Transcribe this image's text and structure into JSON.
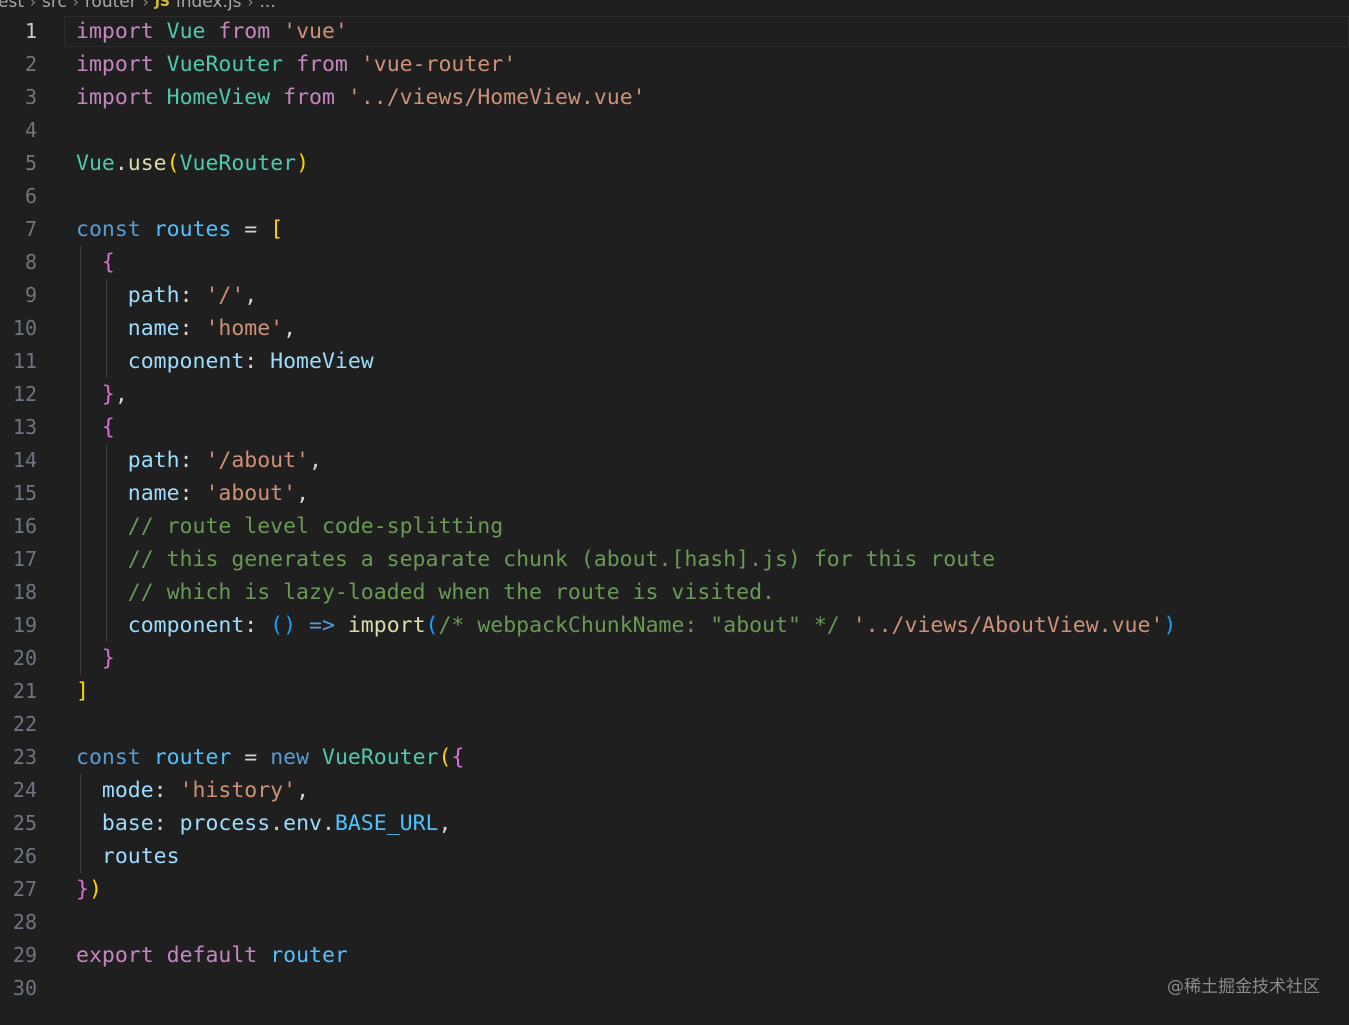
{
  "breadcrumb": [
    "est",
    "src",
    "router",
    "JS",
    "index.js",
    "..."
  ],
  "current_line": 1,
  "colors": {
    "keyword": "#c586c0",
    "declaration": "#569cd6",
    "variable": "#4fc1ff",
    "class": "#4ec9b0",
    "string": "#ce9178",
    "property": "#9cdcfe",
    "function": "#dcdcaa",
    "comment": "#6a9955",
    "bracket_level1": "#ffd700",
    "bracket_level2": "#da70d6",
    "bracket_level3": "#179fff"
  },
  "lines": [
    {
      "n": "1",
      "indent": 0,
      "tokens": [
        [
          "keyword",
          "import"
        ],
        [
          "p",
          " "
        ],
        [
          "class",
          "Vue"
        ],
        [
          "p",
          " "
        ],
        [
          "keyword",
          "from"
        ],
        [
          "p",
          " "
        ],
        [
          "string",
          "'vue'"
        ]
      ]
    },
    {
      "n": "2",
      "indent": 0,
      "tokens": [
        [
          "keyword",
          "import"
        ],
        [
          "p",
          " "
        ],
        [
          "class",
          "VueRouter"
        ],
        [
          "p",
          " "
        ],
        [
          "keyword",
          "from"
        ],
        [
          "p",
          " "
        ],
        [
          "string",
          "'vue-router'"
        ]
      ]
    },
    {
      "n": "3",
      "indent": 0,
      "tokens": [
        [
          "keyword",
          "import"
        ],
        [
          "p",
          " "
        ],
        [
          "class",
          "HomeView"
        ],
        [
          "p",
          " "
        ],
        [
          "keyword",
          "from"
        ],
        [
          "p",
          " "
        ],
        [
          "string",
          "'../views/HomeView.vue'"
        ]
      ]
    },
    {
      "n": "4",
      "indent": 0,
      "tokens": []
    },
    {
      "n": "5",
      "indent": 0,
      "tokens": [
        [
          "class",
          "Vue"
        ],
        [
          "p",
          "."
        ],
        [
          "function",
          "use"
        ],
        [
          "br1",
          "("
        ],
        [
          "class",
          "VueRouter"
        ],
        [
          "br1",
          ")"
        ]
      ]
    },
    {
      "n": "6",
      "indent": 0,
      "tokens": []
    },
    {
      "n": "7",
      "indent": 0,
      "tokens": [
        [
          "decl",
          "const"
        ],
        [
          "p",
          " "
        ],
        [
          "var",
          "routes"
        ],
        [
          "p",
          " = "
        ],
        [
          "br1",
          "["
        ]
      ]
    },
    {
      "n": "8",
      "indent": 1,
      "tokens": [
        [
          "p",
          "  "
        ],
        [
          "br2",
          "{"
        ]
      ]
    },
    {
      "n": "9",
      "indent": 2,
      "tokens": [
        [
          "p",
          "    "
        ],
        [
          "prop",
          "path"
        ],
        [
          "p",
          ": "
        ],
        [
          "string",
          "'/'"
        ],
        [
          "p",
          ","
        ]
      ]
    },
    {
      "n": "10",
      "indent": 2,
      "tokens": [
        [
          "p",
          "    "
        ],
        [
          "prop",
          "name"
        ],
        [
          "p",
          ": "
        ],
        [
          "string",
          "'home'"
        ],
        [
          "p",
          ","
        ]
      ]
    },
    {
      "n": "11",
      "indent": 2,
      "tokens": [
        [
          "p",
          "    "
        ],
        [
          "prop",
          "component"
        ],
        [
          "p",
          ": "
        ],
        [
          "prop",
          "HomeView"
        ]
      ]
    },
    {
      "n": "12",
      "indent": 1,
      "tokens": [
        [
          "p",
          "  "
        ],
        [
          "br2",
          "}"
        ],
        [
          "p",
          ","
        ]
      ]
    },
    {
      "n": "13",
      "indent": 1,
      "tokens": [
        [
          "p",
          "  "
        ],
        [
          "br2",
          "{"
        ]
      ]
    },
    {
      "n": "14",
      "indent": 2,
      "tokens": [
        [
          "p",
          "    "
        ],
        [
          "prop",
          "path"
        ],
        [
          "p",
          ": "
        ],
        [
          "string",
          "'/about'"
        ],
        [
          "p",
          ","
        ]
      ]
    },
    {
      "n": "15",
      "indent": 2,
      "tokens": [
        [
          "p",
          "    "
        ],
        [
          "prop",
          "name"
        ],
        [
          "p",
          ": "
        ],
        [
          "string",
          "'about'"
        ],
        [
          "p",
          ","
        ]
      ]
    },
    {
      "n": "16",
      "indent": 2,
      "tokens": [
        [
          "p",
          "    "
        ],
        [
          "comment",
          "// route level code-splitting"
        ]
      ]
    },
    {
      "n": "17",
      "indent": 2,
      "tokens": [
        [
          "p",
          "    "
        ],
        [
          "comment",
          "// this generates a separate chunk (about.[hash].js) for this route"
        ]
      ]
    },
    {
      "n": "18",
      "indent": 2,
      "tokens": [
        [
          "p",
          "    "
        ],
        [
          "comment",
          "// which is lazy-loaded when the route is visited."
        ]
      ]
    },
    {
      "n": "19",
      "indent": 2,
      "tokens": [
        [
          "p",
          "    "
        ],
        [
          "prop",
          "component"
        ],
        [
          "p",
          ": "
        ],
        [
          "br3",
          "()"
        ],
        [
          "p",
          " "
        ],
        [
          "decl",
          "=>"
        ],
        [
          "p",
          " "
        ],
        [
          "function",
          "import"
        ],
        [
          "br3",
          "("
        ],
        [
          "comment",
          "/* webpackChunkName: \"about\" */"
        ],
        [
          "p",
          " "
        ],
        [
          "string",
          "'../views/AboutView.vue'"
        ],
        [
          "br3",
          ")"
        ]
      ]
    },
    {
      "n": "20",
      "indent": 1,
      "tokens": [
        [
          "p",
          "  "
        ],
        [
          "br2",
          "}"
        ]
      ]
    },
    {
      "n": "21",
      "indent": 0,
      "tokens": [
        [
          "br1",
          "]"
        ]
      ]
    },
    {
      "n": "22",
      "indent": 0,
      "tokens": []
    },
    {
      "n": "23",
      "indent": 0,
      "tokens": [
        [
          "decl",
          "const"
        ],
        [
          "p",
          " "
        ],
        [
          "var",
          "router"
        ],
        [
          "p",
          " = "
        ],
        [
          "decl",
          "new"
        ],
        [
          "p",
          " "
        ],
        [
          "class",
          "VueRouter"
        ],
        [
          "br1",
          "("
        ],
        [
          "br2",
          "{"
        ]
      ]
    },
    {
      "n": "24",
      "indent": 1,
      "tokens": [
        [
          "p",
          "  "
        ],
        [
          "prop",
          "mode"
        ],
        [
          "p",
          ": "
        ],
        [
          "string",
          "'history'"
        ],
        [
          "p",
          ","
        ]
      ]
    },
    {
      "n": "25",
      "indent": 1,
      "tokens": [
        [
          "p",
          "  "
        ],
        [
          "prop",
          "base"
        ],
        [
          "p",
          ": "
        ],
        [
          "prop",
          "process"
        ],
        [
          "p",
          "."
        ],
        [
          "prop",
          "env"
        ],
        [
          "p",
          "."
        ],
        [
          "var",
          "BASE_URL"
        ],
        [
          "p",
          ","
        ]
      ]
    },
    {
      "n": "26",
      "indent": 1,
      "tokens": [
        [
          "p",
          "  "
        ],
        [
          "prop",
          "routes"
        ]
      ]
    },
    {
      "n": "27",
      "indent": 0,
      "tokens": [
        [
          "br2",
          "}"
        ],
        [
          "br1",
          ")"
        ]
      ]
    },
    {
      "n": "28",
      "indent": 0,
      "tokens": []
    },
    {
      "n": "29",
      "indent": 0,
      "tokens": [
        [
          "keyword",
          "export"
        ],
        [
          "p",
          " "
        ],
        [
          "keyword",
          "default"
        ],
        [
          "p",
          " "
        ],
        [
          "var",
          "router"
        ]
      ]
    },
    {
      "n": "30",
      "indent": 0,
      "tokens": []
    }
  ],
  "watermark": "@稀土掘金技术社区"
}
